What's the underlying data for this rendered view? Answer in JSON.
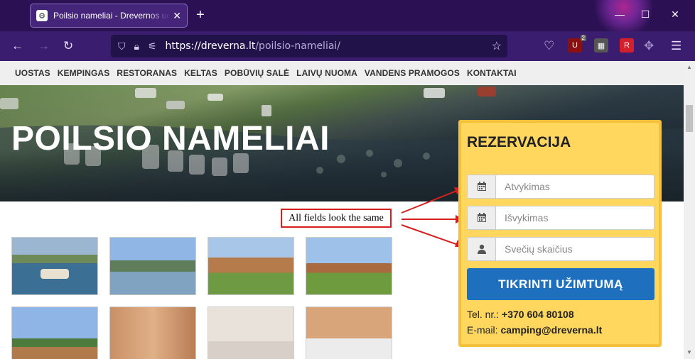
{
  "browser": {
    "tab_title": "Poilsio nameliai - Drevernos uostas",
    "url_domain": "https://dreverna.lt",
    "url_path": "/poilsio-nameliai/",
    "extension_badge": "2"
  },
  "site_nav": {
    "items": [
      "UOSTAS",
      "KEMPINGAS",
      "RESTORANAS",
      "KELTAS",
      "POBŪVIŲ SALĖ",
      "LAIVŲ NUOMA",
      "VANDENS PRAMOGOS",
      "KONTAKTAI"
    ]
  },
  "hero": {
    "title": "POILSIO NAMELIAI"
  },
  "annotation": {
    "text": "All fields look the same",
    "color": "#d42020"
  },
  "reservation": {
    "title": "REZERVACIJA",
    "fields": [
      {
        "icon": "calendar-icon",
        "placeholder": "Atvykimas"
      },
      {
        "icon": "calendar-icon",
        "placeholder": "Išvykimas"
      },
      {
        "icon": "user-icon",
        "placeholder": "Svečių skaičius"
      }
    ],
    "button_label": "TIKRINTI UŽIMTUMĄ",
    "phone_label": "Tel. nr.:",
    "phone": "+370 604 80108",
    "email_label": "E-mail:",
    "email": "camping@dreverna.lt",
    "background_color": "#ffd65e",
    "button_color": "#1f6fbf"
  }
}
